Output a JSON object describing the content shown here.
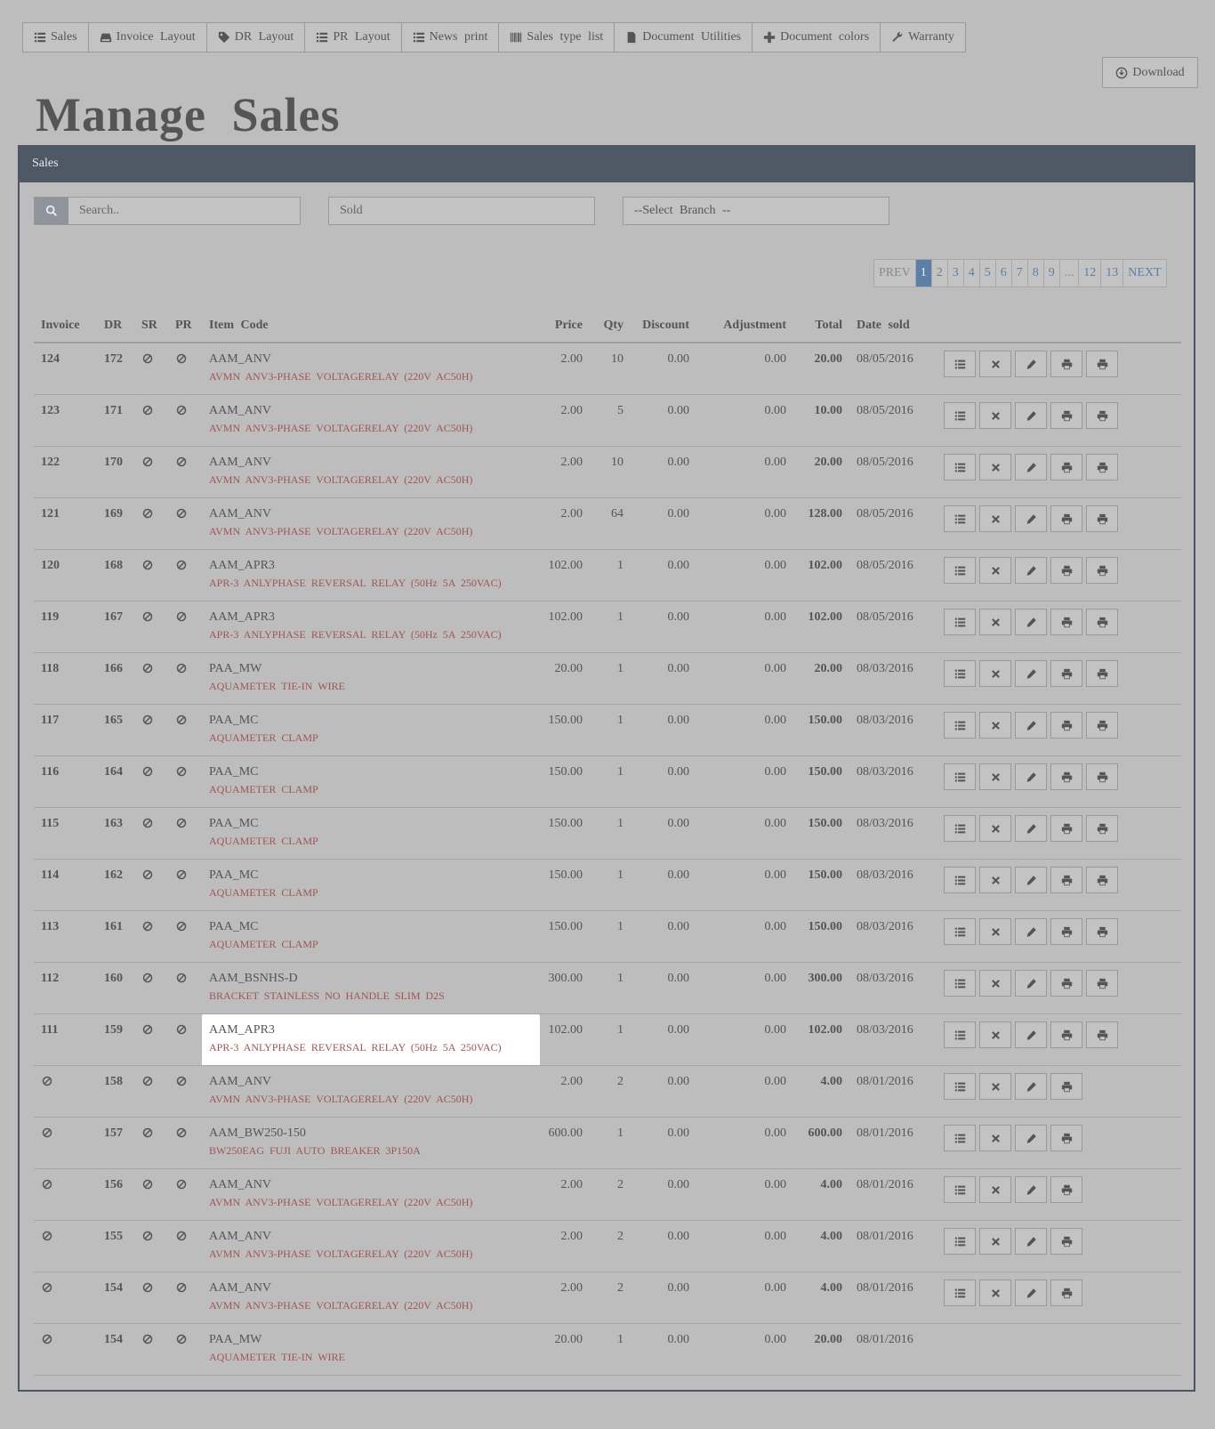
{
  "nav": [
    {
      "label": "Sales",
      "icon": "list-icon"
    },
    {
      "label": "Invoice Layout",
      "icon": "hdd-icon"
    },
    {
      "label": "DR Layout",
      "icon": "tag-icon"
    },
    {
      "label": "PR Layout",
      "icon": "list-icon"
    },
    {
      "label": "News print",
      "icon": "list-icon"
    },
    {
      "label": "Sales type list",
      "icon": "barcode-icon"
    },
    {
      "label": "Document Utilities",
      "icon": "file-icon"
    },
    {
      "label": "Document colors",
      "icon": "plus-icon"
    },
    {
      "label": "Warranty",
      "icon": "wrench-icon"
    }
  ],
  "download_label": "Download",
  "page_title": "Manage Sales",
  "panel_title": "Sales",
  "filters": {
    "search_placeholder": "Search..",
    "sold_placeholder": "Sold",
    "branch_label": "--Select Branch --"
  },
  "pagination": [
    "PREV",
    "1",
    "2",
    "3",
    "4",
    "5",
    "6",
    "7",
    "8",
    "9",
    "...",
    "12",
    "13",
    "NEXT"
  ],
  "pagination_active": "1",
  "columns": {
    "invoice": "Invoice",
    "dr": "DR",
    "sr": "SR",
    "pr": "PR",
    "item_code": "Item Code",
    "price": "Price",
    "qty": "Qty",
    "discount": "Discount",
    "adjustment": "Adjustment",
    "total": "Total",
    "date_sold": "Date sold"
  },
  "rows": [
    {
      "invoice": "124",
      "dr": "172",
      "code": "AAM_ANV",
      "desc": "AVMN ANV3-PHASE VOLTAGERELAY (220V AC50H)",
      "price": "2.00",
      "qty": "10",
      "discount": "0.00",
      "adjustment": "0.00",
      "total": "20.00",
      "date": "08/05/2016",
      "actions": 5
    },
    {
      "invoice": "123",
      "dr": "171",
      "code": "AAM_ANV",
      "desc": "AVMN ANV3-PHASE VOLTAGERELAY (220V AC50H)",
      "price": "2.00",
      "qty": "5",
      "discount": "0.00",
      "adjustment": "0.00",
      "total": "10.00",
      "date": "08/05/2016",
      "actions": 5
    },
    {
      "invoice": "122",
      "dr": "170",
      "code": "AAM_ANV",
      "desc": "AVMN ANV3-PHASE VOLTAGERELAY (220V AC50H)",
      "price": "2.00",
      "qty": "10",
      "discount": "0.00",
      "adjustment": "0.00",
      "total": "20.00",
      "date": "08/05/2016",
      "actions": 5
    },
    {
      "invoice": "121",
      "dr": "169",
      "code": "AAM_ANV",
      "desc": "AVMN ANV3-PHASE VOLTAGERELAY (220V AC50H)",
      "price": "2.00",
      "qty": "64",
      "discount": "0.00",
      "adjustment": "0.00",
      "total": "128.00",
      "date": "08/05/2016",
      "actions": 5
    },
    {
      "invoice": "120",
      "dr": "168",
      "code": "AAM_APR3",
      "desc": "APR-3 ANLYPHASE REVERSAL RELAY (50Hz 5A 250VAC)",
      "price": "102.00",
      "qty": "1",
      "discount": "0.00",
      "adjustment": "0.00",
      "total": "102.00",
      "date": "08/05/2016",
      "actions": 5
    },
    {
      "invoice": "119",
      "dr": "167",
      "code": "AAM_APR3",
      "desc": "APR-3 ANLYPHASE REVERSAL RELAY (50Hz 5A 250VAC)",
      "price": "102.00",
      "qty": "1",
      "discount": "0.00",
      "adjustment": "0.00",
      "total": "102.00",
      "date": "08/05/2016",
      "actions": 5
    },
    {
      "invoice": "118",
      "dr": "166",
      "code": "PAA_MW",
      "desc": "AQUAMETER TIE-IN WIRE",
      "price": "20.00",
      "qty": "1",
      "discount": "0.00",
      "adjustment": "0.00",
      "total": "20.00",
      "date": "08/03/2016",
      "actions": 5
    },
    {
      "invoice": "117",
      "dr": "165",
      "code": "PAA_MC",
      "desc": "AQUAMETER CLAMP",
      "price": "150.00",
      "qty": "1",
      "discount": "0.00",
      "adjustment": "0.00",
      "total": "150.00",
      "date": "08/03/2016",
      "actions": 5
    },
    {
      "invoice": "116",
      "dr": "164",
      "code": "PAA_MC",
      "desc": "AQUAMETER CLAMP",
      "price": "150.00",
      "qty": "1",
      "discount": "0.00",
      "adjustment": "0.00",
      "total": "150.00",
      "date": "08/03/2016",
      "actions": 5
    },
    {
      "invoice": "115",
      "dr": "163",
      "code": "PAA_MC",
      "desc": "AQUAMETER CLAMP",
      "price": "150.00",
      "qty": "1",
      "discount": "0.00",
      "adjustment": "0.00",
      "total": "150.00",
      "date": "08/03/2016",
      "actions": 5
    },
    {
      "invoice": "114",
      "dr": "162",
      "code": "PAA_MC",
      "desc": "AQUAMETER CLAMP",
      "price": "150.00",
      "qty": "1",
      "discount": "0.00",
      "adjustment": "0.00",
      "total": "150.00",
      "date": "08/03/2016",
      "actions": 5
    },
    {
      "invoice": "113",
      "dr": "161",
      "code": "PAA_MC",
      "desc": "AQUAMETER CLAMP",
      "price": "150.00",
      "qty": "1",
      "discount": "0.00",
      "adjustment": "0.00",
      "total": "150.00",
      "date": "08/03/2016",
      "actions": 5
    },
    {
      "invoice": "112",
      "dr": "160",
      "code": "AAM_BSNHS-D",
      "desc": "BRACKET STAINLESS NO HANDLE SLIM D2S",
      "price": "300.00",
      "qty": "1",
      "discount": "0.00",
      "adjustment": "0.00",
      "total": "300.00",
      "date": "08/03/2016",
      "actions": 5
    },
    {
      "invoice": "111",
      "dr": "159",
      "code": "AAM_APR3",
      "desc": "APR-3 ANLYPHASE REVERSAL RELAY (50Hz 5A 250VAC)",
      "price": "102.00",
      "qty": "1",
      "discount": "0.00",
      "adjustment": "0.00",
      "total": "102.00",
      "date": "08/03/2016",
      "actions": 5,
      "highlight": true
    },
    {
      "invoice": "",
      "dr": "158",
      "code": "AAM_ANV",
      "desc": "AVMN ANV3-PHASE VOLTAGERELAY (220V AC50H)",
      "price": "2.00",
      "qty": "2",
      "discount": "0.00",
      "adjustment": "0.00",
      "total": "4.00",
      "date": "08/01/2016",
      "actions": 4
    },
    {
      "invoice": "",
      "dr": "157",
      "code": "AAM_BW250-150",
      "desc": "BW250EAG FUJI AUTO BREAKER 3P150A",
      "price": "600.00",
      "qty": "1",
      "discount": "0.00",
      "adjustment": "0.00",
      "total": "600.00",
      "date": "08/01/2016",
      "actions": 4
    },
    {
      "invoice": "",
      "dr": "156",
      "code": "AAM_ANV",
      "desc": "AVMN ANV3-PHASE VOLTAGERELAY (220V AC50H)",
      "price": "2.00",
      "qty": "2",
      "discount": "0.00",
      "adjustment": "0.00",
      "total": "4.00",
      "date": "08/01/2016",
      "actions": 4
    },
    {
      "invoice": "",
      "dr": "155",
      "code": "AAM_ANV",
      "desc": "AVMN ANV3-PHASE VOLTAGERELAY (220V AC50H)",
      "price": "2.00",
      "qty": "2",
      "discount": "0.00",
      "adjustment": "0.00",
      "total": "4.00",
      "date": "08/01/2016",
      "actions": 4
    },
    {
      "invoice": "",
      "dr": "154",
      "code": "AAM_ANV",
      "desc": "AVMN ANV3-PHASE VOLTAGERELAY (220V AC50H)",
      "price": "2.00",
      "qty": "2",
      "discount": "0.00",
      "adjustment": "0.00",
      "total": "4.00",
      "date": "08/01/2016",
      "actions": 4
    },
    {
      "invoice": "",
      "dr": "154",
      "code": "PAA_MW",
      "desc": "AQUAMETER TIE-IN WIRE",
      "price": "20.00",
      "qty": "1",
      "discount": "0.00",
      "adjustment": "0.00",
      "total": "20.00",
      "date": "08/01/2016",
      "actions": 0
    }
  ],
  "action_icons": [
    "list-icon",
    "remove-icon",
    "pencil-icon",
    "print-icon",
    "print-icon"
  ],
  "colors": {
    "background": "#bdbdbd",
    "panel_header": "#4f5865",
    "accent": "#5b7fa6",
    "description": "#a15454"
  }
}
